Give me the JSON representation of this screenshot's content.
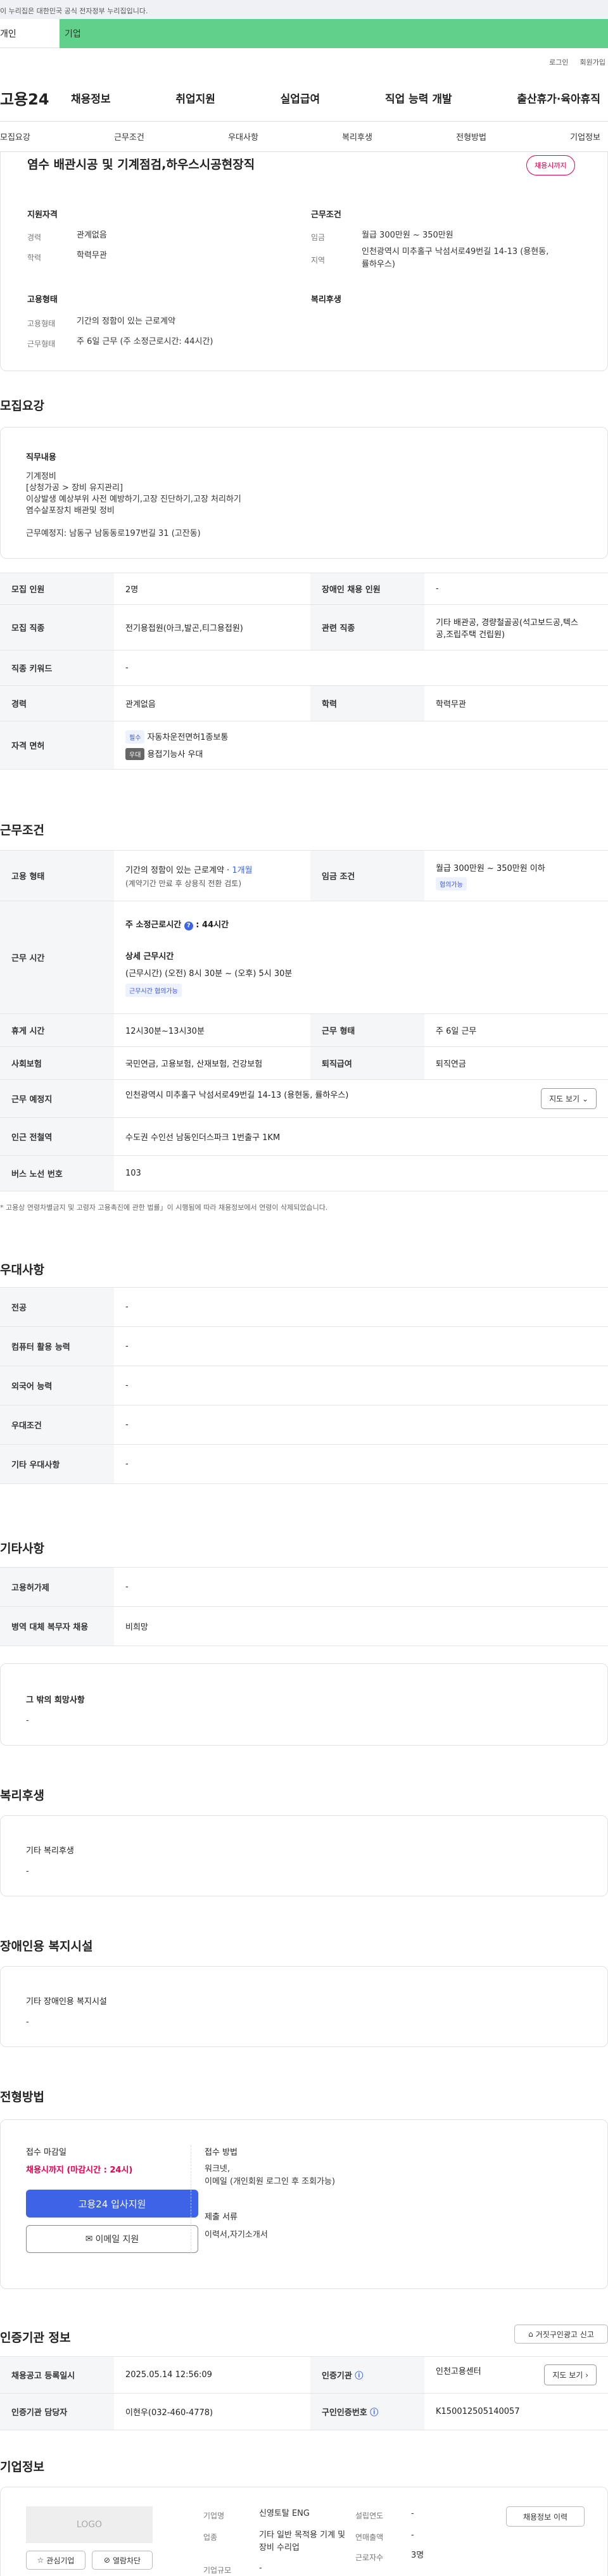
{
  "gov_banner": "이 누리집은 대한민국 공식 전자정부 누리집입니다.",
  "tabs": {
    "personal": "개인",
    "company": "기업"
  },
  "util": {
    "login": "로그인",
    "join": "회원가입"
  },
  "logo": "고용24",
  "gnb": [
    "채용정보",
    "취업지원",
    "실업급여",
    "직업 능력 개발",
    "출산휴가·육아휴직"
  ],
  "snb": [
    "모집요강",
    "근무조건",
    "우대사항",
    "복리후생",
    "전형방법",
    "기업정보"
  ],
  "summary": {
    "title": "염수 배관시공 및 기계점검,하우스시공현장직",
    "badge": "채용시까지",
    "qual_h": "지원자격",
    "cond_h": "근무조건",
    "emp_h": "고용형태",
    "welfare_h": "복리후생",
    "career_k": "경력",
    "career_v": "관계없음",
    "edu_k": "학력",
    "edu_v": "학력무관",
    "wage_k": "임금",
    "wage_v": "월급 300만원 ~ 350만원",
    "region_k": "지역",
    "region_v1": "인천광역시 미추홀구 낙섬서로49번길 14-13 (용현동,",
    "region_v2": "률하우스)",
    "emptype_k": "고용형태",
    "emptype_v": "기간의 정함이 있는 근로계약",
    "worktype_k": "근무형태",
    "worktype_v": "주 6일 근무 (주 소정근로시간: 44시간)"
  },
  "recruit": {
    "title": "모집요강",
    "duty_h": "직무내용",
    "duty_lines": [
      "기계정비",
      "[상청가공 > 장비 유지관리]",
      "이상발생 예상부위 사전 예방하기,고장 진단하기,고장 처리하기",
      "염수살포장치 배관및 정비"
    ],
    "duty_place": "근무예정지: 남동구 남동동로197번길 31 (고잔동)",
    "rows": {
      "hire_k": "모집 인원",
      "hire_v": "2명",
      "dis_k": "장애인 채용 인원",
      "dis_v": "-",
      "job_k": "모집 직종",
      "job_v": "전기용접원(아크,발곤,티그용접원)",
      "rel_k": "관련 직종",
      "rel_v1": "기타 배관공, 경량철골공(석고보드공,텍스",
      "rel_v2": "공,조립주택 건립원)",
      "kw_k": "직종 키워드",
      "kw_v": "-",
      "career_k": "경력",
      "career_v": "관계없음",
      "edu_k": "학력",
      "edu_v": "학력무관",
      "lic_k": "자격 면허",
      "lic1_tag": "필수",
      "lic1": "자동차운전면허1종보통",
      "lic2_tag": "우대",
      "lic2": "용접기능사 우대"
    }
  },
  "work": {
    "title": "근무조건",
    "emp_k": "고용 형태",
    "emp_v1a": "기간의 정함이 있는 근로계약 · ",
    "emp_v1b": "1개월",
    "emp_v2": "(계약기간 만료 후 상용직 전환 검토)",
    "wage_k": "임금 조건",
    "wage_v": "월급 300만원 ~ 350만원 이하",
    "wage_tag": "협의가능",
    "time_k": "근무 시간",
    "time_week": "주 소정근로시간",
    "time_week_v": "44시간",
    "time_detail_h": "상세 근무시간",
    "time_detail": "(근무시간) (오전) 8시 30분 ~ (오후) 5시 30분",
    "time_tag": "근무시간 협의가능",
    "rest_k": "휴게 시간",
    "rest_v": "12시30분~13시30분",
    "form_k": "근무 형태",
    "form_v": "주 6일 근무",
    "ins_k": "사회보험",
    "ins_v": "국민연금, 고용보험, 산재보험, 건강보험",
    "ret_k": "퇴직급여",
    "ret_v": "퇴직연금",
    "place_k": "근무 예정지",
    "place_v": "인천광역시 미추홀구 낙섬서로49번길 14-13 (용현동, 률하우스)",
    "map_btn": "지도 보기",
    "sub_k": "인근 전철역",
    "sub_v": "수도권 수인선 남동인더스파크 1번출구 1KM",
    "bus_k": "버스 노선 번호",
    "bus_v": "103",
    "note": "* 고용상 연령차별금지 및 고령자 고용촉진에 관한 법률」이 시행됨에 따라 채용정보에서 연령이 삭제되었습니다."
  },
  "pref": {
    "title": "우대사항",
    "rows": [
      [
        "전공",
        "-"
      ],
      [
        "컴퓨터 활용 능력",
        "-"
      ],
      [
        "외국어 능력",
        "-"
      ],
      [
        "우대조건",
        "-"
      ],
      [
        "기타 우대사항",
        "-"
      ]
    ]
  },
  "etc": {
    "title": "기타사항",
    "rows": [
      [
        "고용허가제",
        "-"
      ],
      [
        "병역 대체 복무자 채용",
        "비희망"
      ]
    ],
    "hope_h": "그 밖의 희망사항",
    "hope_v": "-"
  },
  "welfare": {
    "title": "복리후생",
    "h": "기타 복리후생",
    "v": "-"
  },
  "disab": {
    "title": "장애인용 복지시설",
    "h": "기타 장애인용 복지시설",
    "v": "-"
  },
  "process": {
    "title": "전형방법",
    "deadline_h": "접수 마감일",
    "deadline_v": "채용시까지 (마감시간 : 24시)",
    "apply_btn": "고용24 입사지원",
    "mail_btn": "이메일 지원",
    "method_h": "접수 방법",
    "method_v1": "워크넷,",
    "method_v2": "이메일 (개인회원 로그인 후 조회가능)",
    "docs_h": "제출 서류",
    "docs_v": "이력서,자기소개서"
  },
  "agency": {
    "title": "인증기관 정보",
    "report_btn": "거짓구인광고 신고",
    "reg_k": "채용공고 등록일시",
    "reg_v": "2025.05.14 12:56:09",
    "org_k": "인증기관",
    "org_v": "인천고용센터",
    "map_btn": "지도 보기",
    "mgr_k": "인증기관 담당자",
    "mgr_v": "이현우(032-460-4778)",
    "no_k": "구인인증번호",
    "no_v": "K150012505140057"
  },
  "company": {
    "title": "기업정보",
    "logo": "LOGO",
    "fav_btn": "관심기업",
    "block_btn": "열람차단",
    "name_k": "기업명",
    "name_v": "신영토탈 ENG",
    "est_k": "설립연도",
    "est_v": "-",
    "ind_k": "업종",
    "ind_v1": "기타 일반 목적용 기계 및",
    "ind_v2": "장비 수리업",
    "sales_k": "연매출액",
    "sales_v": "-",
    "size_k": "기업규모",
    "size_v": "-",
    "emp_k": "근로자수",
    "emp_v": "3명",
    "jobs_btn": "채용정보 이력"
  },
  "colors": {
    "accent": "#3e63e6",
    "badge": "#e4004f",
    "green": "#60d08a"
  }
}
